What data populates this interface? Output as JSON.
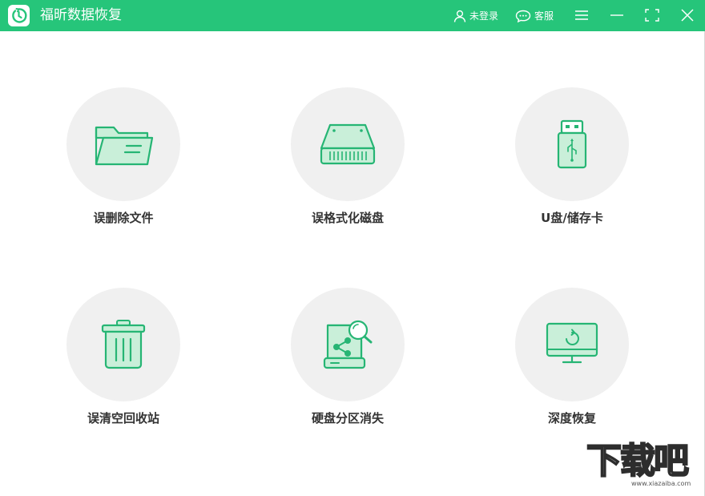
{
  "app": {
    "title": "福昕数据恢复",
    "accent_color": "#26c57a",
    "icon": "clock-refresh-icon"
  },
  "header": {
    "login_label": "未登录",
    "support_label": "客服",
    "user_icon": "user-icon",
    "chat_icon": "chat-icon",
    "menu_icon": "menu-icon",
    "minimize_icon": "minimize-icon",
    "maximize_icon": "maximize-icon",
    "close_icon": "close-icon"
  },
  "options": [
    {
      "label": "误删除文件",
      "icon": "folder-icon"
    },
    {
      "label": "误格式化磁盘",
      "icon": "hard-disk-icon"
    },
    {
      "label": "U盘/储存卡",
      "icon": "usb-drive-icon"
    },
    {
      "label": "误清空回收站",
      "icon": "recycle-bin-icon"
    },
    {
      "label": "硬盘分区消失",
      "icon": "disk-partition-search-icon"
    },
    {
      "label": "深度恢复",
      "icon": "monitor-restore-icon"
    }
  ],
  "watermark": {
    "text": "下载吧",
    "url": "www.xiazaiba.com"
  }
}
